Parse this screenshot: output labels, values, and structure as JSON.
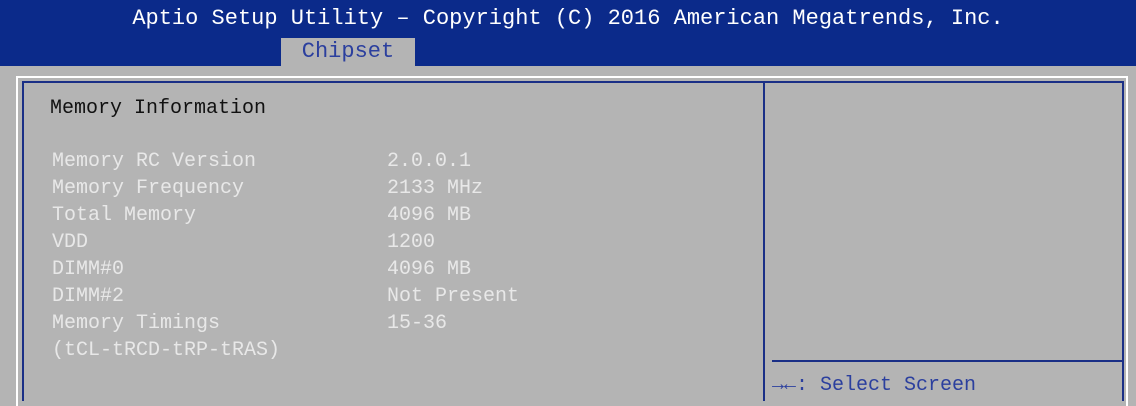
{
  "header": {
    "title": "Aptio Setup Utility – Copyright (C) 2016 American Megatrends, Inc.",
    "active_tab": "Chipset"
  },
  "section": {
    "title": "Memory Information"
  },
  "rows": [
    {
      "label": "Memory RC Version",
      "value": "2.0.0.1"
    },
    {
      "label": "Memory Frequency",
      "value": "2133 MHz"
    },
    {
      "label": "Total Memory",
      "value": "4096 MB"
    },
    {
      "label": "VDD",
      "value": "1200"
    },
    {
      "label": "DIMM#0",
      "value": "4096 MB"
    },
    {
      "label": "DIMM#2",
      "value": "Not Present"
    },
    {
      "label": "Memory Timings",
      "value": "15-36"
    },
    {
      "label": "(tCL-tRCD-tRP-tRAS)",
      "value": ""
    }
  ],
  "help": {
    "select_screen": "→←: Select Screen"
  },
  "colors": {
    "header_bg": "#0b2a8a",
    "body_bg": "#b4b4b4",
    "info_text": "#e8e8e8",
    "help_text": "#2b3f9e"
  }
}
